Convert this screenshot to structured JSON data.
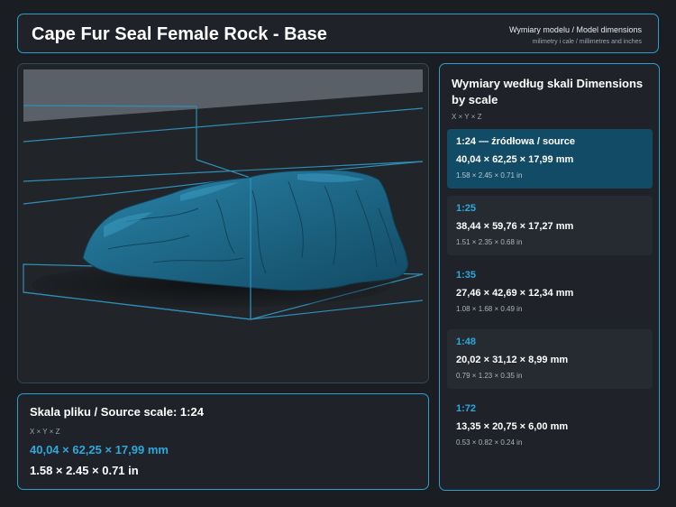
{
  "header": {
    "title": "Cape Fur Seal Female Rock - Base",
    "subtitle": "Wymiary modelu / Model dimensions",
    "units_note": "milimetry i cale / millimetres and inches"
  },
  "source": {
    "title": "Skala pliku / Source scale: 1:24",
    "axes": "X × Y × Z",
    "mm": "40,04 × 62,25 × 17,99 mm",
    "inches": "1.58 × 2.45 × 0.71 in"
  },
  "scales_panel": {
    "title": "Wymiary według skali Dimensions by scale",
    "axes": "X × Y × Z",
    "items": [
      {
        "label": "1:24  —  źródłowa / source",
        "mm": "40,04 × 62,25 × 17,99 mm",
        "inches": "1.58 × 2.45 × 0.71 in",
        "state": "active"
      },
      {
        "label": "1:25",
        "mm": "38,44 × 59,76 × 17,27 mm",
        "inches": "1.51 × 2.35 × 0.68 in",
        "state": "alt"
      },
      {
        "label": "1:35",
        "mm": "27,46 × 42,69 × 12,34 mm",
        "inches": "1.08 × 1.68 × 0.49 in",
        "state": "plain"
      },
      {
        "label": "1:48",
        "mm": "20,02 × 31,12 × 8,99 mm",
        "inches": "0.79 × 1.23 × 0.35 in",
        "state": "alt"
      },
      {
        "label": "1:72",
        "mm": "13,35 × 20,75 × 6,00 mm",
        "inches": "0.53 × 0.82 × 0.24 in",
        "state": "plain"
      }
    ]
  },
  "colors": {
    "accent": "#2c9fce",
    "model": "#1e6a8a",
    "active_card": "#124b66"
  }
}
